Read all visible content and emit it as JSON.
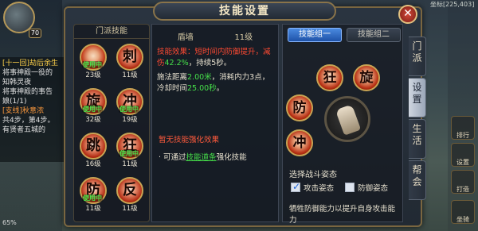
{
  "background": {
    "player_level": "70",
    "coord": "坐标[225,403]",
    "quest_lines": [
      {
        "text": "[十一回]劫后余生",
        "style": "q-head"
      },
      {
        "text": "将事神殿一役的",
        "style": ""
      },
      {
        "text": "知韩灵夜",
        "style": ""
      },
      {
        "text": "将事神殿的事告",
        "style": ""
      },
      {
        "text": "娘(1/1)",
        "style": ""
      },
      {
        "text": "[支线]秋意浓",
        "style": "q-orange"
      },
      {
        "text": "共4步，第4步。",
        "style": ""
      },
      {
        "text": "有贤者五城的",
        "style": ""
      }
    ],
    "bottom_left": "65%",
    "side_buttons": [
      {
        "label": "排行"
      },
      {
        "label": "设置"
      },
      {
        "label": "打造"
      },
      {
        "label": "坐骑"
      }
    ]
  },
  "panel": {
    "title": "技能设置",
    "close_label": "✕"
  },
  "left_column": {
    "header": "门派技能",
    "skills": [
      {
        "glyph": "",
        "level": "23级",
        "in_use": "使用中",
        "style": "red"
      },
      {
        "glyph": "刺",
        "level": "11级",
        "in_use": "",
        "style": "dark red"
      },
      {
        "glyph": "旋",
        "level": "32级",
        "in_use": "使用中",
        "style": "dark red"
      },
      {
        "glyph": "冲",
        "level": "19级",
        "in_use": "使用中",
        "style": "dark red"
      },
      {
        "glyph": "跳",
        "level": "16级",
        "in_use": "",
        "style": "dark red"
      },
      {
        "glyph": "狂",
        "level": "11级",
        "in_use": "使用中",
        "style": "dark red"
      },
      {
        "glyph": "防",
        "level": "11级",
        "in_use": "使用中",
        "style": "dark red"
      },
      {
        "glyph": "反",
        "level": "11级",
        "in_use": "",
        "style": "dark red"
      }
    ]
  },
  "middle_column": {
    "skill_name": "盾墙",
    "skill_level": "11级",
    "effect_label": "技能效果：",
    "effect_text_1": "短时间内防御提升，减伤",
    "effect_pct": "42.2%",
    "effect_text_2": "，持续5秒。",
    "cast_prefix": "施法距离",
    "cast_range": "2.00米",
    "cast_middle": "，消耗内力3点，冷却时间",
    "cooldown": "25.00秒",
    "cast_end": "。",
    "no_enhance": "暂无技能强化效果",
    "via_prefix": "· 可通过",
    "via_link": "技能道条",
    "via_suffix": "强化技能"
  },
  "right_column": {
    "group_one": "技能组一",
    "group_two": "技能组二",
    "wheel": {
      "top_left": "狂",
      "top_right": "旋",
      "left": "防",
      "bottom_left": "冲"
    },
    "stance_label": "选择战斗姿态",
    "attack_stance": "攻击姿态",
    "defense_stance": "防御姿态",
    "stance_desc": "牺牲防御能力以提升自身攻击能力"
  },
  "tabs": [
    {
      "label": "门派",
      "active": false
    },
    {
      "label": "设置",
      "active": true
    },
    {
      "label": "生活",
      "active": false
    },
    {
      "label": "帮会",
      "active": false
    }
  ]
}
